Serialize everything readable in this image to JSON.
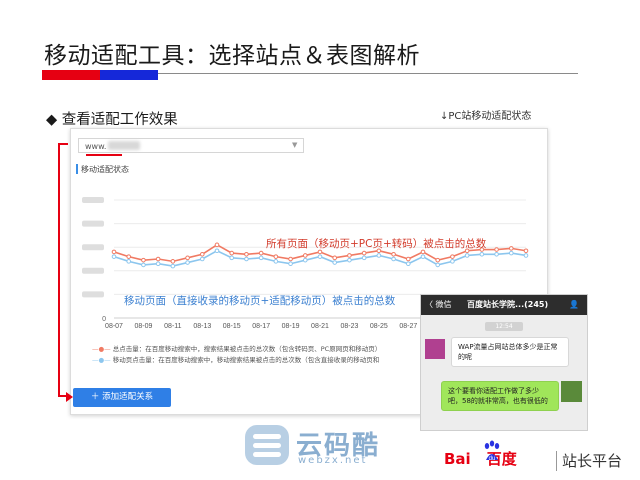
{
  "slide": {
    "title": "移动适配工具：选择站点＆表图解析",
    "section_heading": "◆ 查看适配工作效果",
    "pc_note": "↓PC站移动适配状态"
  },
  "tool_panel": {
    "url_value": "www.",
    "chart_label": "移动适配状态",
    "add_button": "＋ 添加适配关系"
  },
  "annotations": {
    "all_pages": "所有页面（移动页+PC页+转码）被点击的总数",
    "mobile_pages": "移动页面（直接收录的移动页+适配移动页）被点击的总数"
  },
  "legend": {
    "total_clicks": "总点击量：在百度移动搜索中，搜索结果被点击的总次数（包含转码页、PC原网页和移动页）",
    "mobile_clicks": "移动页点击量：在百度移动搜索中，移动搜索结果被点击的总次数（包含直接收录的移动页和"
  },
  "chart_data": {
    "type": "line",
    "x_tick_labels": [
      "08-07",
      "08-09",
      "08-11",
      "08-13",
      "08-15",
      "08-17",
      "08-19",
      "08-21",
      "08-23",
      "08-25",
      "08-27"
    ],
    "x": [
      "08-07",
      "08-08",
      "08-09",
      "08-10",
      "08-11",
      "08-12",
      "08-13",
      "08-14",
      "08-15",
      "08-16",
      "08-17",
      "08-18",
      "08-19",
      "08-20",
      "08-21",
      "08-22",
      "08-23",
      "08-24",
      "08-25",
      "08-26",
      "08-27",
      "08-28",
      "08-29",
      "08-30",
      "08-31",
      "09-01",
      "09-02",
      "09-03",
      "09-04"
    ],
    "ylabel_tick": "0",
    "series": [
      {
        "values": [
          56,
          52,
          49,
          50,
          48,
          51,
          54,
          62,
          55,
          54,
          55,
          52,
          50,
          53,
          56,
          51,
          53,
          55,
          57,
          54,
          50,
          56,
          49,
          52,
          57,
          58,
          58,
          59,
          57
        ]
      },
      {
        "values": [
          52,
          48,
          45,
          46,
          44,
          47,
          50,
          57,
          51,
          50,
          51,
          48,
          46,
          49,
          52,
          47,
          49,
          51,
          53,
          50,
          46,
          52,
          45,
          48,
          53,
          54,
          54,
          55,
          53
        ]
      }
    ],
    "ylim": [
      0,
      100
    ],
    "colors": {
      "total": "#f07a63",
      "mobile": "#8cc6ee"
    }
  },
  "chat": {
    "back_label": "〈 微信",
    "group_title": "百度站长学院...(245)",
    "time": "12:54",
    "message_left": "WAP流量占网站总体多少是正常的呢",
    "message_right": "这个要看你适配工作做了多少吧，58的就非常高，也有很低的"
  },
  "watermark": {
    "brand": "云码酷",
    "url": "webzx.net"
  },
  "baidu": {
    "logo_text_a": "Bai",
    "logo_text_b": "du",
    "logo_text_c": "百度",
    "platform": "站长平台"
  }
}
